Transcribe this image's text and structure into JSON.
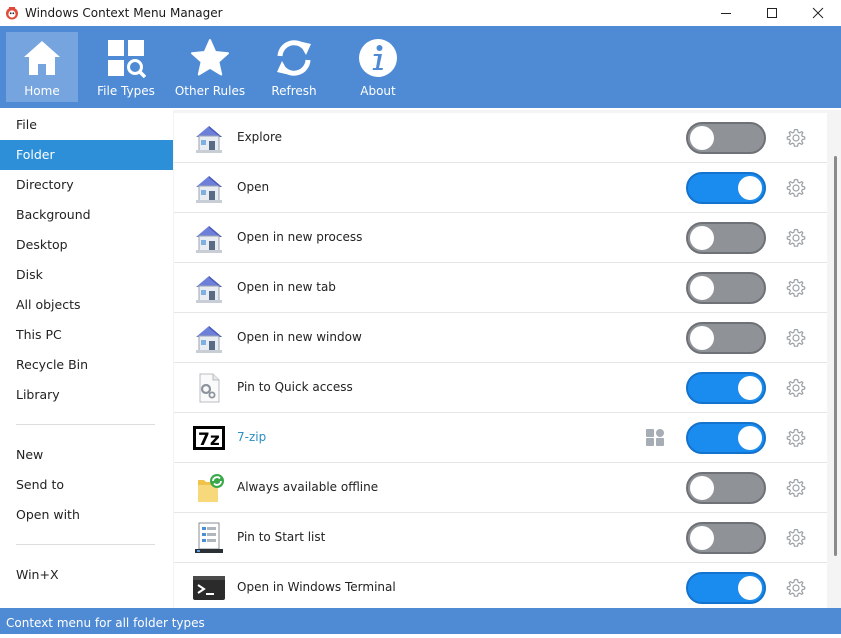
{
  "window": {
    "title": "Windows Context Menu Manager"
  },
  "toolbar": {
    "items": [
      {
        "label": "Home",
        "icon": "home-icon",
        "active": true
      },
      {
        "label": "File Types",
        "icon": "file-types-icon",
        "active": false
      },
      {
        "label": "Other Rules",
        "icon": "star-icon",
        "active": false
      },
      {
        "label": "Refresh",
        "icon": "refresh-icon",
        "active": false
      },
      {
        "label": "About",
        "icon": "info-icon",
        "active": false
      }
    ]
  },
  "sidebar": {
    "group1": [
      "File",
      "Folder",
      "Directory",
      "Background",
      "Desktop",
      "Disk",
      "All objects",
      "This PC",
      "Recycle Bin",
      "Library"
    ],
    "group2": [
      "New",
      "Send to",
      "Open with"
    ],
    "group3": [
      "Win+X"
    ],
    "active": "Folder"
  },
  "list": {
    "items": [
      {
        "label": "Explore",
        "icon": "house-icon",
        "enabled": false
      },
      {
        "label": "Open",
        "icon": "house-icon",
        "enabled": true
      },
      {
        "label": "Open in new process",
        "icon": "house-icon",
        "enabled": false
      },
      {
        "label": "Open in new tab",
        "icon": "house-icon",
        "enabled": false
      },
      {
        "label": "Open in new window",
        "icon": "house-icon",
        "enabled": false
      },
      {
        "label": "Pin to Quick access",
        "icon": "settings-file-icon",
        "enabled": true
      },
      {
        "label": "7-zip",
        "icon": "7zip-icon",
        "enabled": true,
        "link": true,
        "extra_icon": "shell-extension-icon"
      },
      {
        "label": "Always available offline",
        "icon": "sync-folder-icon",
        "enabled": false
      },
      {
        "label": "Pin to Start list",
        "icon": "start-list-icon",
        "enabled": false
      },
      {
        "label": "Open in Windows Terminal",
        "icon": "terminal-icon",
        "enabled": true
      }
    ]
  },
  "status": {
    "text": "Context menu for all folder types"
  },
  "colors": {
    "accent": "#4f8bd5",
    "selection": "#2d8fd8",
    "toggle_on": "#1a8cf0",
    "toggle_off": "#8f9297"
  }
}
